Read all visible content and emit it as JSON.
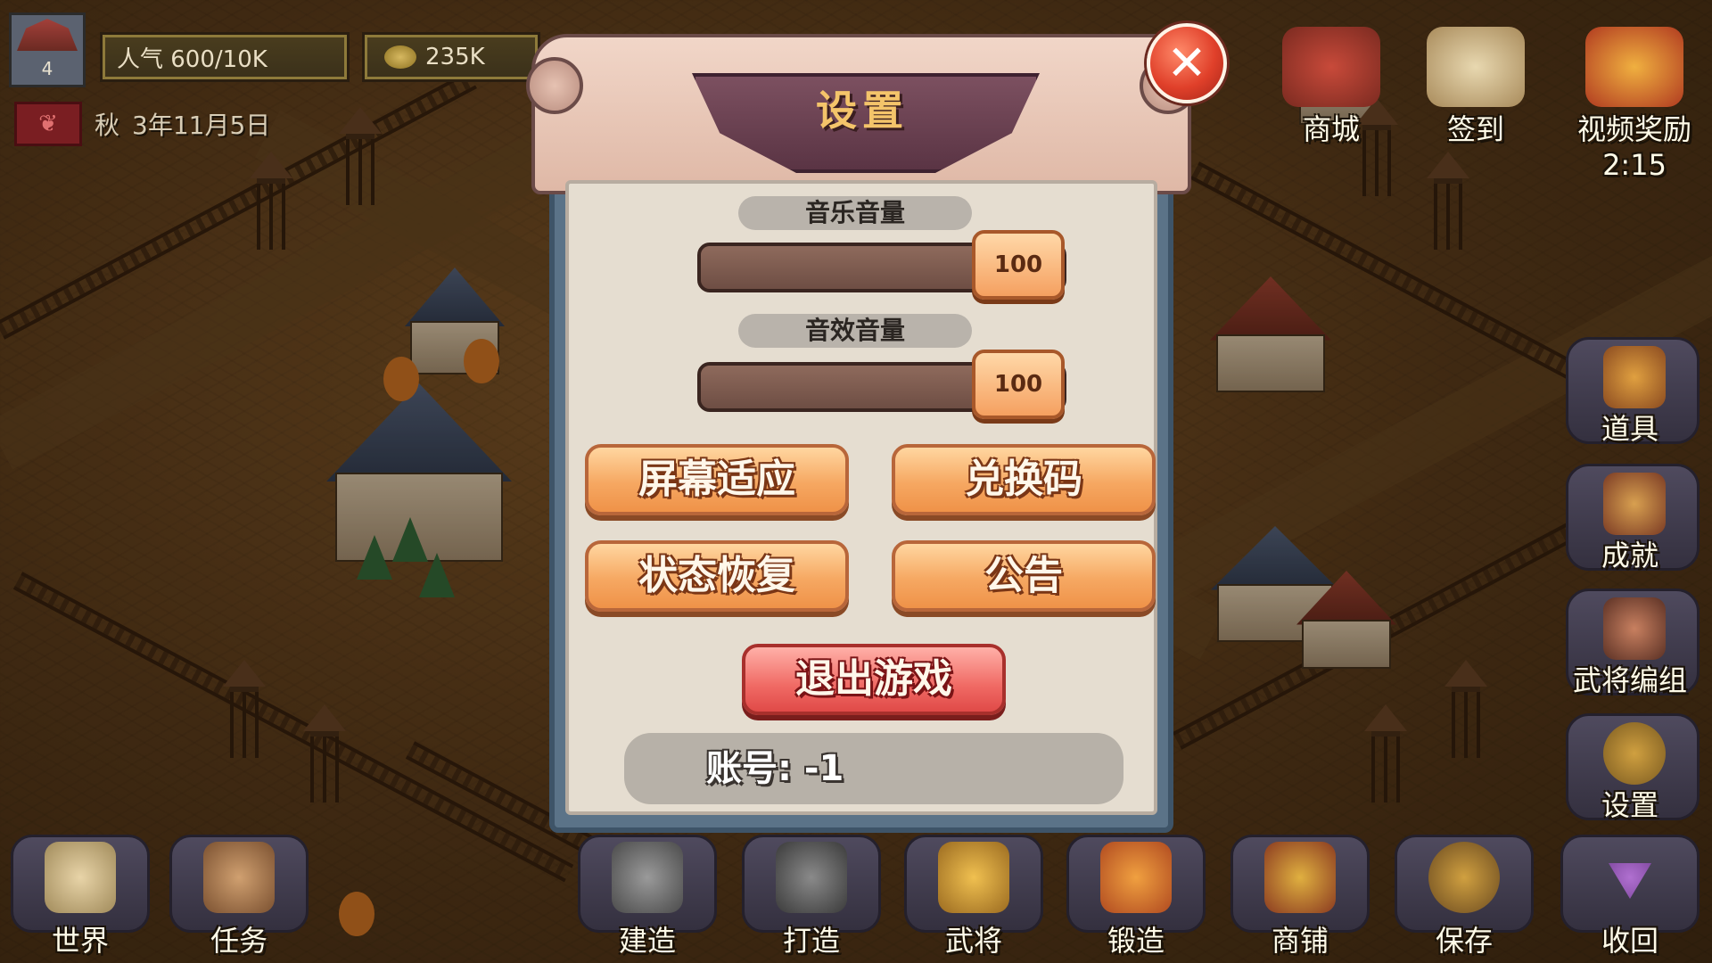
{
  "hud": {
    "level": "4",
    "popularity": "人气 600/10K",
    "gold": "235K",
    "season": "秋",
    "date": "3年11月5日"
  },
  "top_right": [
    {
      "label": "商城",
      "icon": "shop-icon"
    },
    {
      "label": "签到",
      "icon": "scroll-icon"
    },
    {
      "label": "视频奖励",
      "icon": "gift-bag-icon",
      "timer": "2:15"
    }
  ],
  "side_menu": [
    {
      "label": "道具",
      "icon": "items-bag-icon"
    },
    {
      "label": "成就",
      "icon": "trophy-scroll-icon"
    },
    {
      "label": "武将编组",
      "icon": "fist-icon"
    },
    {
      "label": "设置",
      "icon": "gear-icon"
    }
  ],
  "bottom_bar": [
    {
      "label": "世界",
      "icon": "world-map-icon"
    },
    {
      "label": "任务",
      "icon": "logs-icon"
    },
    {
      "label": "建造",
      "icon": "hammer-icon"
    },
    {
      "label": "打造",
      "icon": "anvil-icon"
    },
    {
      "label": "武将",
      "icon": "general-helmet-icon"
    },
    {
      "label": "锻造",
      "icon": "forge-icon"
    },
    {
      "label": "商铺",
      "icon": "coin-shop-icon"
    },
    {
      "label": "保存",
      "icon": "save-gear-icon"
    },
    {
      "label": "收回",
      "icon": "collapse-arrow-icon"
    }
  ],
  "settings": {
    "title": "设置",
    "music_label": "音乐音量",
    "music_value": "100",
    "music_level": 1.0,
    "sfx_label": "音效音量",
    "sfx_value": "100",
    "sfx_level": 1.0,
    "screen_fit": "屏幕适应",
    "redeem_code": "兑换码",
    "restore_state": "状态恢复",
    "announcement": "公告",
    "exit_game": "退出游戏",
    "account": "账号: -1",
    "close_symbol": "✕"
  },
  "colors": {
    "button_orange": "#f6a862",
    "button_red": "#f06a64",
    "close_red": "#e0402a",
    "title_gold": "#f4c46a"
  }
}
